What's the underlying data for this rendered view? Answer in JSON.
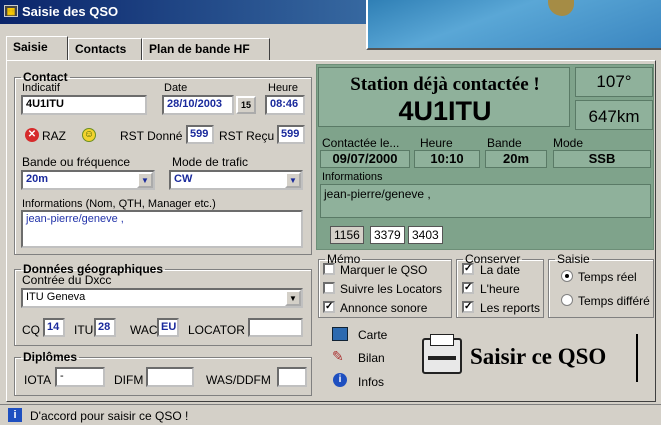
{
  "window": {
    "title": "Saisie des QSO"
  },
  "tabs": [
    "Saisie",
    "Contacts",
    "Plan de bande HF"
  ],
  "contact": {
    "legend": "Contact",
    "indicatif_label": "Indicatif",
    "indicatif_value": "4U1ITU",
    "date_label": "Date",
    "date_value": "28/10/2003",
    "calendar_btn": "15",
    "heure_label": "Heure",
    "heure_value": "08:46",
    "raz_label": "RAZ",
    "rst_donne_label": "RST Donné",
    "rst_donne_value": "599",
    "rst_recu_label": "RST Reçu",
    "rst_recu_value": "599",
    "bande_label": "Bande ou fréquence",
    "bande_value": "20m",
    "mode_label": "Mode de trafic",
    "mode_value": "CW",
    "info_label": "Informations (Nom, QTH, Manager etc.)",
    "info_value": "jean-pierre/geneve ,"
  },
  "geo": {
    "legend": "Données géographiques",
    "dxcc_label": "Contrée du Dxcc",
    "dxcc_value": "ITU Geneva",
    "cq_label": "CQ",
    "cq_value": "14",
    "itu_label": "ITU",
    "itu_value": "28",
    "wac_label": "WAC",
    "wac_value": "EU",
    "locator_label": "LOCATOR",
    "locator_value": ""
  },
  "diplomes": {
    "legend": "Diplômes",
    "iota_label": "IOTA",
    "iota_value": "-",
    "difm_label": "DIFM",
    "difm_value": "",
    "was_label": "WAS/DDFM",
    "was_value": ""
  },
  "station": {
    "banner": "Station déjà contactée !",
    "callsign": "4U1ITU",
    "bearing": "107°",
    "distance": "647km"
  },
  "last_contact": {
    "date_label": "Contactée le...",
    "date_value": "09/07/2000",
    "heure_label": "Heure",
    "heure_value": "10:10",
    "bande_label": "Bande",
    "bande_value": "20m",
    "mode_label": "Mode",
    "mode_value": "SSB",
    "info_label": "Informations",
    "info_value": "jean-pierre/geneve ,",
    "subtabs": [
      "1156",
      "3379",
      "3403"
    ]
  },
  "memo": {
    "legend": "Mémo",
    "items": [
      {
        "label": "Marquer le QSO",
        "checked": false
      },
      {
        "label": "Suivre les Locators",
        "checked": false
      },
      {
        "label": "Annonce sonore",
        "checked": true
      }
    ]
  },
  "conserver": {
    "legend": "Conserver",
    "items": [
      {
        "label": "La date",
        "checked": true
      },
      {
        "label": "L'heure",
        "checked": true
      },
      {
        "label": "Les reports",
        "checked": true
      }
    ]
  },
  "saisie_mode": {
    "legend": "Saisie",
    "options": [
      {
        "label": "Temps réel",
        "selected": true
      },
      {
        "label": "Temps différé",
        "selected": false
      }
    ]
  },
  "actions": {
    "carte": "Carte",
    "bilan": "Bilan",
    "infos": "Infos",
    "saisir": "Saisir ce QSO"
  },
  "status": {
    "message": "D'accord pour saisir ce QSO !"
  }
}
